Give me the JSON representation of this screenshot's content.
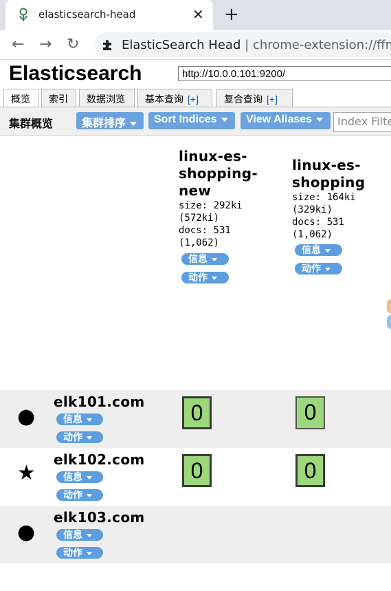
{
  "browser": {
    "tab_title": "elasticsearch-head",
    "url_site": "ElasticSearch Head",
    "url_separator": "|",
    "url_path": "chrome-extension://ffmki"
  },
  "app": {
    "title": "Elasticsearch",
    "connect_url": "http://10.0.0.101:9200/",
    "tabs": [
      {
        "label": "概览"
      },
      {
        "label": "索引"
      },
      {
        "label": "数据浏览"
      },
      {
        "label": "基本查询",
        "plus": "[+]"
      },
      {
        "label": "复合查询",
        "plus": "[+]"
      }
    ],
    "toolbar": {
      "title": "集群概览",
      "cluster_sort": "集群排序",
      "sort_indices": "Sort Indices",
      "view_aliases": "View Aliases",
      "index_filter_placeholder": "Index Filter"
    },
    "indices": [
      {
        "name_lines": [
          "linux-es-",
          "shopping-",
          "new"
        ],
        "size_line1": "size: 292ki",
        "size_line2": "(572ki)",
        "docs_line1": "docs: 531",
        "docs_line2": "(1,062)",
        "info": "信息",
        "actions": "动作"
      },
      {
        "name_lines": [
          "linux-es-",
          "shopping"
        ],
        "size_line1": "size: 164ki",
        "size_line2": "(329ki)",
        "docs_line1": "docs: 531",
        "docs_line2": "(1,062)",
        "info": "信息",
        "actions": "动作"
      }
    ],
    "nodes": [
      {
        "name": "elk101.com",
        "icon": "circle-icon",
        "symbol": "●",
        "info": "信息",
        "actions": "动作",
        "shards": [
          "0",
          "0"
        ]
      },
      {
        "name": "elk102.com",
        "icon": "star-icon",
        "symbol": "★",
        "info": "信息",
        "actions": "动作",
        "shards": [
          "0",
          "0"
        ]
      },
      {
        "name": "elk103.com",
        "icon": "circle-icon",
        "symbol": "●",
        "info": "信息",
        "actions": "动作",
        "shards": []
      }
    ],
    "colors": {
      "button_blue": "#6aa3de",
      "pill_blue": "#5c9ee0",
      "shard_green": "#9cd87a",
      "row_gray": "#eeeeee"
    }
  }
}
